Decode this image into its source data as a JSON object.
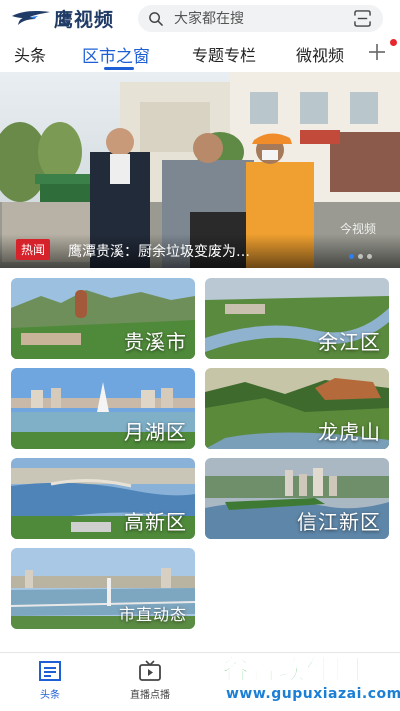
{
  "app": {
    "name": "鹰视频"
  },
  "search": {
    "placeholder": "大家都在搜"
  },
  "tabs": [
    {
      "label": "头条",
      "active": false
    },
    {
      "label": "区市之窗",
      "active": true
    },
    {
      "label": "专题专栏",
      "active": false
    },
    {
      "label": "微视频",
      "active": false
    }
  ],
  "banner": {
    "badge": "热闻",
    "caption": "鹰潭贵溪：厨余垃圾变废为…",
    "video_mark": "今视频",
    "dots": 3,
    "active_dot": 1
  },
  "regions": [
    {
      "label": "贵溪市"
    },
    {
      "label": "余江区"
    },
    {
      "label": "月湖区"
    },
    {
      "label": "龙虎山"
    },
    {
      "label": "高新区"
    },
    {
      "label": "信江新区"
    },
    {
      "label": "市直动态"
    }
  ],
  "bottom_nav": [
    {
      "label": "头条",
      "icon": "news-icon",
      "active": true
    },
    {
      "label": "直播点播",
      "icon": "tv-icon",
      "active": false
    }
  ],
  "watermark": {
    "title": "谷普软件园",
    "url": "www.gupuxiazai.com"
  },
  "colors": {
    "accent": "#1f5fd6",
    "badge": "#d6232b",
    "watermark_green": "#2bb04a",
    "watermark_blue": "#1b7fd6"
  }
}
